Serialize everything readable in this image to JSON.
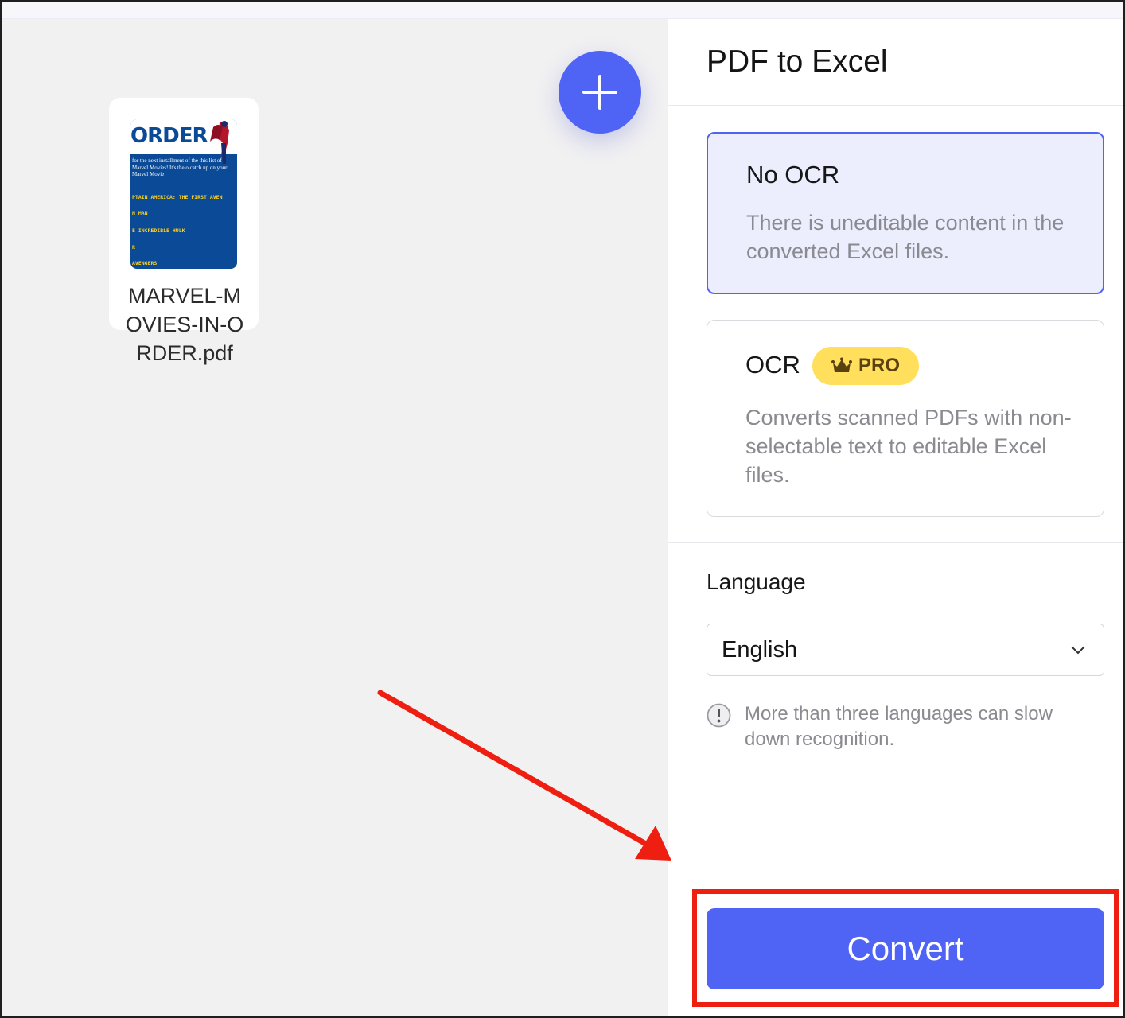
{
  "file": {
    "name": "MARVEL-MOVIES-IN-ORDER.pdf",
    "thumbnail": {
      "title": "ORDER",
      "blurb": "for the next installment of the this list of Marvel Movies! It's the o catch up on your Marvel Movie",
      "items": [
        "PTAIN AMERICA: THE FIRST AVEN",
        "N MAN",
        "E INCREDIBLE HULK",
        "R",
        "AVENGERS"
      ]
    }
  },
  "workspace": {
    "add_icon": "plus-icon"
  },
  "panel": {
    "title": "PDF to Excel",
    "options": [
      {
        "title": "No OCR",
        "description": "There is uneditable content in the converted Excel files.",
        "selected": true
      },
      {
        "title": "OCR",
        "badge": "PRO",
        "badge_icon": "crown-icon",
        "description": "Converts scanned PDFs with non-selectable text to editable Excel files.",
        "selected": false
      }
    ],
    "language": {
      "label": "Language",
      "selected": "English",
      "warning": "More than three languages can slow down recognition."
    },
    "convert_label": "Convert"
  },
  "colors": {
    "accent": "#4f63f5",
    "selected_bg": "#eceefe",
    "pro_badge": "#ffdf5c",
    "annotation": "#ee1f10"
  }
}
